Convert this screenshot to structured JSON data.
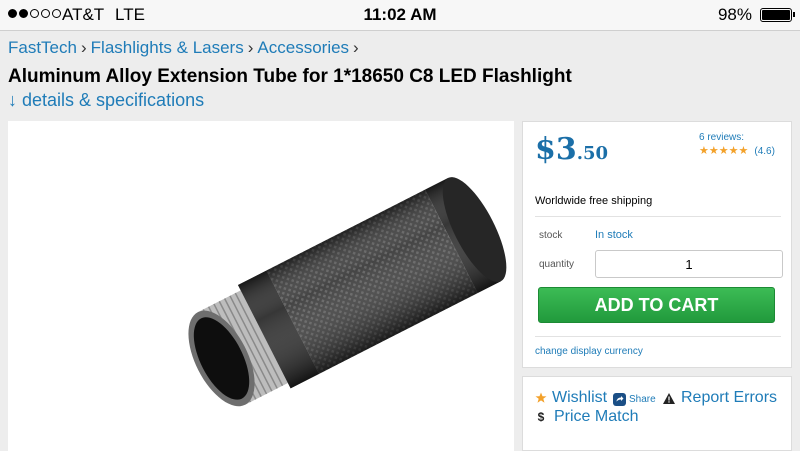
{
  "status_bar": {
    "carrier": "AT&T",
    "network": "LTE",
    "time": "11:02 AM",
    "battery": "98%",
    "battery_level": 0.98,
    "signal_bars_filled": 2,
    "signal_bars_total": 5
  },
  "breadcrumb": {
    "items": [
      "FastTech",
      "Flashlights & Lasers",
      "Accessories"
    ],
    "separator": "›"
  },
  "product": {
    "title": "Aluminum Alloy Extension Tube for 1*18650 C8 LED Flashlight",
    "details_link": "↓ details & specifications"
  },
  "buy_box": {
    "price_currency": "$",
    "price_main": "3",
    "price_cents": ".50",
    "reviews_text": "6 reviews:",
    "stars": 5,
    "rating_text": "(4.6)",
    "shipping": "Worldwide free shipping",
    "stock_label": "stock",
    "stock_value": "In stock",
    "quantity_label": "quantity",
    "quantity_value": "1",
    "add_to_cart": "ADD TO CART",
    "change_currency": "change display currency"
  },
  "actions": {
    "wishlist": "Wishlist",
    "share": "Share",
    "report_errors": "Report Errors",
    "price_match": "Price Match"
  },
  "colors": {
    "link": "#1f7cb8",
    "price": "#1b6fa8",
    "cart_button": "#2cac47",
    "star": "#f3a12a"
  },
  "icons": [
    "star-icon",
    "share-icon",
    "warning-icon",
    "dollar-icon"
  ]
}
